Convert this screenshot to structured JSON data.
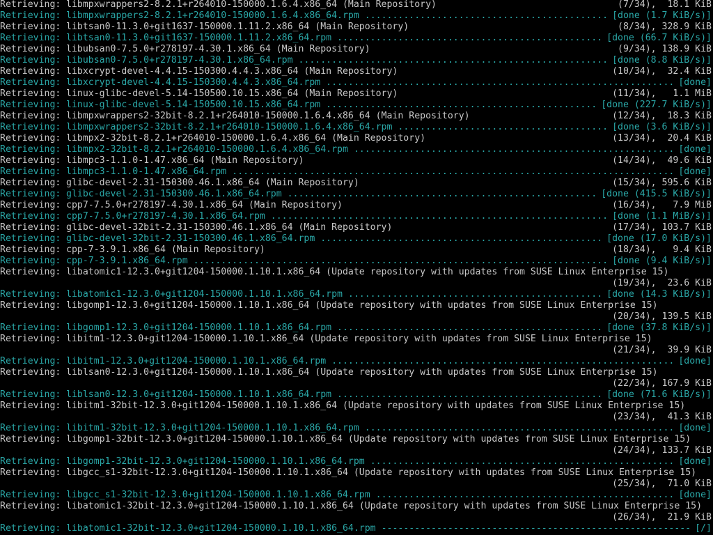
{
  "colors": {
    "background": "#000000",
    "normal_text": "#c8c8c8",
    "cyan_text": "#2aa7a7"
  },
  "terminal": {
    "lines": [
      {
        "kind": "retrieve",
        "prefix": "Retrieving:",
        "text": "libmpxwrappers2-8.2.1+r264010-150000.1.6.4.x86_64 (Main Repository)",
        "status": "(7/34),  18.1 KiB"
      },
      {
        "kind": "download",
        "prefix": "Retrieving:",
        "text": "libmpxwrappers2-8.2.1+r264010-150000.1.6.4.x86_64.rpm ",
        "status": "[done (1.7 KiB/s)]"
      },
      {
        "kind": "retrieve",
        "prefix": "Retrieving:",
        "text": "libtsan0-11.3.0+git1637-150000.1.11.2.x86_64 (Main Repository)",
        "status": "(8/34), 328.9 KiB"
      },
      {
        "kind": "download",
        "prefix": "Retrieving:",
        "text": "libtsan0-11.3.0+git1637-150000.1.11.2.x86_64.rpm ",
        "status": "[done (66.7 KiB/s)]"
      },
      {
        "kind": "retrieve",
        "prefix": "Retrieving:",
        "text": "libubsan0-7.5.0+r278197-4.30.1.x86_64 (Main Repository)",
        "status": "(9/34), 138.9 KiB"
      },
      {
        "kind": "download",
        "prefix": "Retrieving:",
        "text": "libubsan0-7.5.0+r278197-4.30.1.x86_64.rpm ",
        "status": "[done (8.8 KiB/s)]"
      },
      {
        "kind": "retrieve",
        "prefix": "Retrieving:",
        "text": "libxcrypt-devel-4.4.15-150300.4.4.3.x86_64 (Main Repository)",
        "status": "(10/34),  32.4 KiB"
      },
      {
        "kind": "download",
        "prefix": "Retrieving:",
        "text": "libxcrypt-devel-4.4.15-150300.4.4.3.x86_64.rpm ",
        "status": "[done]"
      },
      {
        "kind": "retrieve",
        "prefix": "Retrieving:",
        "text": "linux-glibc-devel-5.14-150500.10.15.x86_64 (Main Repository)",
        "status": "(11/34),   1.1 MiB"
      },
      {
        "kind": "download",
        "prefix": "Retrieving:",
        "text": "linux-glibc-devel-5.14-150500.10.15.x86_64.rpm ",
        "status": "[done (227.7 KiB/s)]"
      },
      {
        "kind": "retrieve",
        "prefix": "Retrieving:",
        "text": "libmpxwrappers2-32bit-8.2.1+r264010-150000.1.6.4.x86_64 (Main Repository)",
        "status": "(12/34),  18.3 KiB"
      },
      {
        "kind": "download",
        "prefix": "Retrieving:",
        "text": "libmpxwrappers2-32bit-8.2.1+r264010-150000.1.6.4.x86_64.rpm ",
        "status": "[done (3.6 KiB/s)]"
      },
      {
        "kind": "retrieve",
        "prefix": "Retrieving:",
        "text": "libmpx2-32bit-8.2.1+r264010-150000.1.6.4.x86_64 (Main Repository)",
        "status": "(13/34),  20.4 KiB"
      },
      {
        "kind": "download",
        "prefix": "Retrieving:",
        "text": "libmpx2-32bit-8.2.1+r264010-150000.1.6.4.x86_64.rpm ",
        "status": "[done]"
      },
      {
        "kind": "retrieve",
        "prefix": "Retrieving:",
        "text": "libmpc3-1.1.0-1.47.x86_64 (Main Repository)",
        "status": "(14/34),  49.6 KiB"
      },
      {
        "kind": "download",
        "prefix": "Retrieving:",
        "text": "libmpc3-1.1.0-1.47.x86_64.rpm ",
        "status": "[done]"
      },
      {
        "kind": "retrieve",
        "prefix": "Retrieving:",
        "text": "glibc-devel-2.31-150300.46.1.x86_64 (Main Repository)",
        "status": "(15/34), 595.6 KiB"
      },
      {
        "kind": "download",
        "prefix": "Retrieving:",
        "text": "glibc-devel-2.31-150300.46.1.x86_64.rpm ",
        "status": "[done (415.5 KiB/s)]"
      },
      {
        "kind": "retrieve",
        "prefix": "Retrieving:",
        "text": "cpp7-7.5.0+r278197-4.30.1.x86_64 (Main Repository)",
        "status": "(16/34),   7.9 MiB"
      },
      {
        "kind": "download",
        "prefix": "Retrieving:",
        "text": "cpp7-7.5.0+r278197-4.30.1.x86_64.rpm ",
        "status": "[done (1.1 MiB/s)]"
      },
      {
        "kind": "retrieve",
        "prefix": "Retrieving:",
        "text": "glibc-devel-32bit-2.31-150300.46.1.x86_64 (Main Repository)",
        "status": "(17/34), 103.7 KiB"
      },
      {
        "kind": "download",
        "prefix": "Retrieving:",
        "text": "glibc-devel-32bit-2.31-150300.46.1.x86_64.rpm ",
        "status": "[done (17.0 KiB/s)]"
      },
      {
        "kind": "retrieve",
        "prefix": "Retrieving:",
        "text": "cpp-7-3.9.1.x86_64 (Main Repository)",
        "status": "(18/34),   9.4 KiB"
      },
      {
        "kind": "download",
        "prefix": "Retrieving:",
        "text": "cpp-7-3.9.1.x86_64.rpm ",
        "status": "[done (9.4 KiB/s)]"
      },
      {
        "kind": "retrieve",
        "prefix": "Retrieving:",
        "text": "libatomic1-12.3.0+git1204-150000.1.10.1.x86_64 (Update repository with updates from SUSE Linux Enterprise 15)",
        "status": ""
      },
      {
        "kind": "size",
        "prefix": "",
        "text": "",
        "status": "(19/34),  23.6 KiB"
      },
      {
        "kind": "download",
        "prefix": "Retrieving:",
        "text": "libatomic1-12.3.0+git1204-150000.1.10.1.x86_64.rpm ",
        "status": "[done (14.3 KiB/s)]"
      },
      {
        "kind": "retrieve",
        "prefix": "Retrieving:",
        "text": "libgomp1-12.3.0+git1204-150000.1.10.1.x86_64 (Update repository with updates from SUSE Linux Enterprise 15)",
        "status": ""
      },
      {
        "kind": "size",
        "prefix": "",
        "text": "",
        "status": "(20/34), 139.5 KiB"
      },
      {
        "kind": "download",
        "prefix": "Retrieving:",
        "text": "libgomp1-12.3.0+git1204-150000.1.10.1.x86_64.rpm ",
        "status": "[done (37.8 KiB/s)]"
      },
      {
        "kind": "retrieve",
        "prefix": "Retrieving:",
        "text": "libitm1-12.3.0+git1204-150000.1.10.1.x86_64 (Update repository with updates from SUSE Linux Enterprise 15)",
        "status": ""
      },
      {
        "kind": "size",
        "prefix": "",
        "text": "",
        "status": "(21/34),  39.9 KiB"
      },
      {
        "kind": "download",
        "prefix": "Retrieving:",
        "text": "libitm1-12.3.0+git1204-150000.1.10.1.x86_64.rpm ",
        "status": "[done]"
      },
      {
        "kind": "retrieve",
        "prefix": "Retrieving:",
        "text": "liblsan0-12.3.0+git1204-150000.1.10.1.x86_64 (Update repository with updates from SUSE Linux Enterprise 15)",
        "status": ""
      },
      {
        "kind": "size",
        "prefix": "",
        "text": "",
        "status": "(22/34), 167.9 KiB"
      },
      {
        "kind": "download",
        "prefix": "Retrieving:",
        "text": "liblsan0-12.3.0+git1204-150000.1.10.1.x86_64.rpm ",
        "status": "[done (71.6 KiB/s)]"
      },
      {
        "kind": "retrieve",
        "prefix": "Retrieving:",
        "text": "libitm1-32bit-12.3.0+git1204-150000.1.10.1.x86_64 (Update repository with updates from SUSE Linux Enterprise 15)",
        "status": ""
      },
      {
        "kind": "size",
        "prefix": "",
        "text": "",
        "status": "(23/34),  41.3 KiB"
      },
      {
        "kind": "download",
        "prefix": "Retrieving:",
        "text": "libitm1-32bit-12.3.0+git1204-150000.1.10.1.x86_64.rpm ",
        "status": "[done]"
      },
      {
        "kind": "retrieve",
        "prefix": "Retrieving:",
        "text": "libgomp1-32bit-12.3.0+git1204-150000.1.10.1.x86_64 (Update repository with updates from SUSE Linux Enterprise 15)",
        "status": ""
      },
      {
        "kind": "size",
        "prefix": "",
        "text": "",
        "status": "(24/34), 133.7 KiB"
      },
      {
        "kind": "download",
        "prefix": "Retrieving:",
        "text": "libgomp1-32bit-12.3.0+git1204-150000.1.10.1.x86_64.rpm ",
        "status": "[done]"
      },
      {
        "kind": "retrieve",
        "prefix": "Retrieving:",
        "text": "libgcc_s1-32bit-12.3.0+git1204-150000.1.10.1.x86_64 (Update repository with updates from SUSE Linux Enterprise 15)",
        "status": ""
      },
      {
        "kind": "size",
        "prefix": "",
        "text": "",
        "status": "(25/34),  71.0 KiB"
      },
      {
        "kind": "download",
        "prefix": "Retrieving:",
        "text": "libgcc_s1-32bit-12.3.0+git1204-150000.1.10.1.x86_64.rpm ",
        "status": "[done]"
      },
      {
        "kind": "retrieve",
        "prefix": "Retrieving:",
        "text": "libatomic1-32bit-12.3.0+git1204-150000.1.10.1.x86_64 (Update repository with updates from SUSE Linux Enterprise 15)",
        "status": ""
      },
      {
        "kind": "size",
        "prefix": "",
        "text": "",
        "status": "(26/34),  21.9 KiB"
      },
      {
        "kind": "progress",
        "prefix": "Retrieving:",
        "text": "libatomic1-32bit-12.3.0+git1204-150000.1.10.1.x86_64.rpm ",
        "status": "[/]"
      }
    ]
  }
}
